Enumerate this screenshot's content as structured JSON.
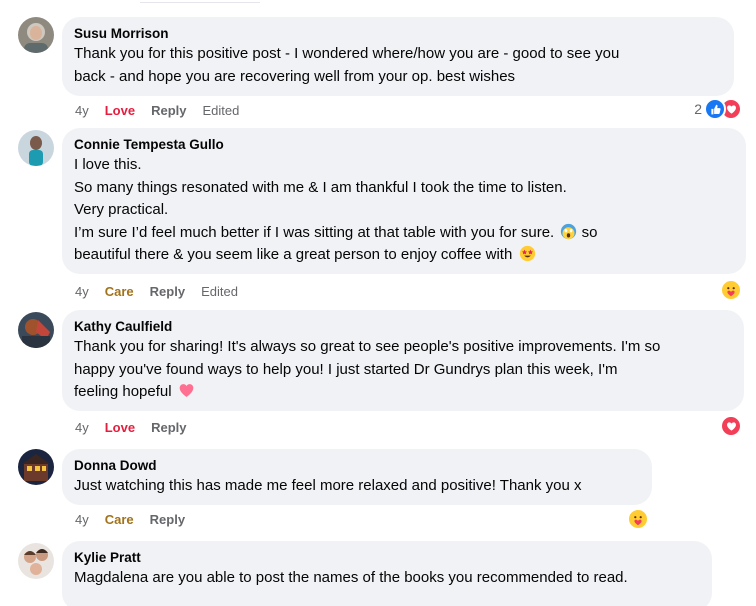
{
  "comments": [
    {
      "author": "Susu Morrison",
      "text": "Thank you for this positive post - I wondered where/how you are - good to see you\nback - and hope you are recovering well from your op. best wishes",
      "age": "4y",
      "reaction_label": "Love",
      "reply_label": "Reply",
      "edited_label": "Edited",
      "reaction_count": "2",
      "avatar_icon": "avatar-grey-hair-woman",
      "badge_icons": [
        "like-icon",
        "love-icon"
      ]
    },
    {
      "author": "Connie Tempesta Gullo",
      "text_lines": [
        "I love this.",
        "So many things resonated with me & I am thankful I took the time to listen.",
        "Very practical.",
        "I’m sure I’d feel much better if I was sitting at that table with you for sure.",
        "so",
        "beautiful there & you seem like a great person to enjoy coffee with"
      ],
      "age": "4y",
      "reaction_label": "Care",
      "reply_label": "Reply",
      "edited_label": "Edited",
      "avatar_icon": "avatar-woman-teal",
      "badge_icons": [
        "care-icon"
      ],
      "inline_emojis": [
        "face-screaming-in-fear-emoji",
        "star-struck-emoji"
      ]
    },
    {
      "author": "Kathy Caulfield",
      "text": "Thank you for sharing! It's always so great to see people's positive improvements. I'm so\nhappy you've found ways to help you! I just started Dr Gundrys plan this week, I'm\nfeeling hopeful",
      "age": "4y",
      "reaction_label": "Love",
      "reply_label": "Reply",
      "avatar_icon": "avatar-kathy",
      "badge_icons": [
        "love-icon"
      ],
      "inline_emojis": [
        "pink-heart-emoji"
      ]
    },
    {
      "author": "Donna Dowd",
      "text": "Just watching this has made me feel more relaxed and positive! Thank you x",
      "age": "4y",
      "reaction_label": "Care",
      "reply_label": "Reply",
      "avatar_icon": "avatar-donna",
      "badge_icons": [
        "care-icon"
      ]
    },
    {
      "author": "Kylie Pratt",
      "text": "Magdalena are you able to post the names of the books you recommended to read.",
      "avatar_icon": "avatar-kylie-family"
    }
  ],
  "colors": {
    "bubble_bg": "#f0f2f5",
    "meta_text": "#65676b",
    "love": "#e41e3f",
    "care": "#a1721b",
    "like_blue": "#1877f2"
  }
}
